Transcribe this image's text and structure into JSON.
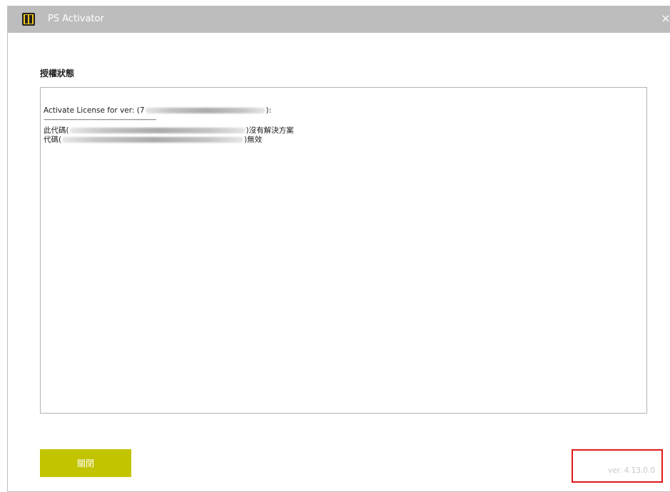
{
  "window": {
    "title": "PS Activator",
    "close_glyph": "×"
  },
  "status": {
    "heading": "授權狀態",
    "lines": {
      "line1_prefix": "Activate  License for  ver:  (7",
      "line1_suffix": "):",
      "separator": "----------------------------------------------------------------------",
      "line2_prefix": "此代碼(",
      "line2_suffix": ")沒有解決方案",
      "line3_prefix": "代碼(",
      "line3_suffix": ")無效"
    }
  },
  "footer": {
    "close_label": "關閉",
    "version": "ver. 4.13.0.0"
  },
  "colors": {
    "titlebar": "#bdbdbd",
    "accent_button": "#c3c400",
    "highlight": "#e01919",
    "app_icon": "#f2c81a"
  },
  "icons": {
    "app": "ps-activator-app-icon",
    "close": "close-icon"
  }
}
